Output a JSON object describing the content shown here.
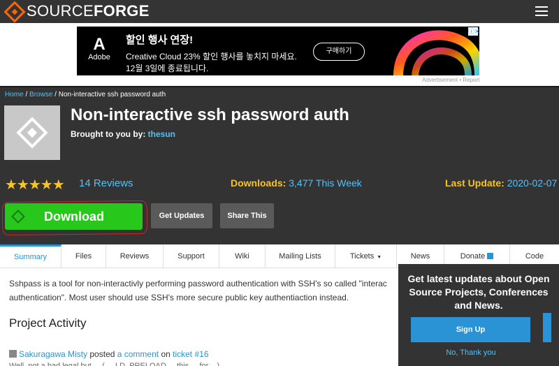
{
  "header": {
    "logo_light": "SOURCE",
    "logo_bold": "FORGE"
  },
  "ad": {
    "brand": "Adobe",
    "title": "할인 행사 연장!",
    "line1": "Creative Cloud 23% 할인 행사를 놓치지 마세요.",
    "line2": "12월 3일에 종료됩니다.",
    "button": "구매하기",
    "close": "ⓘ✕",
    "note": "Advertisement • Report"
  },
  "breadcrumb": {
    "home": "Home",
    "sep1": " / ",
    "browse": "Browse",
    "sep2": " / ",
    "current": "Non-interactive ssh password auth"
  },
  "project": {
    "title": "Non-interactive ssh password auth",
    "brought_label": "Brought to you by:",
    "author": "thesun",
    "stars": "★★★★★",
    "reviews": "14 Reviews",
    "downloads_label": "Downloads:",
    "downloads_value": "3,477 This Week",
    "last_update_label": "Last Update:",
    "last_update_value": "2020-02-07",
    "rating": 4.5
  },
  "buttons": {
    "download": "Download",
    "get_updates": "Get Updates",
    "share": "Share This"
  },
  "tabs": [
    "Summary",
    "Files",
    "Reviews",
    "Support",
    "Wiki",
    "Mailing Lists",
    "Tickets",
    "News",
    "Donate",
    "Code"
  ],
  "summary": {
    "line1": "Sshpass is a tool for non-interactivly performing password authentication with SSH's so called \"interac",
    "line2": "authentication\". Most user should use SSH's more secure public key authentiaction instead."
  },
  "activity": {
    "title": "Project Activity",
    "user": "Sakuragawa Misty",
    "verb": " posted ",
    "item": "a comment",
    "prep": " on ",
    "ticket": "ticket #16",
    "cut_text": "Well,   not a bad   legal  but   ...  (  ... LD_PRELOAD  ...  this ... for  ...)"
  },
  "popup": {
    "text": "Get latest updates about Open Source Projects, Conferences and News.",
    "button": "Sign Up",
    "decline": "No, Thank you"
  },
  "colors": {
    "accent": "#2a93d5",
    "download": "#27c81b",
    "brand": "#ff6600",
    "star": "#f5c42a"
  }
}
